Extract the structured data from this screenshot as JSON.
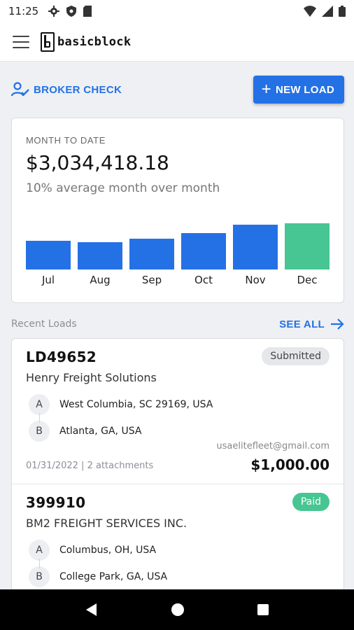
{
  "status_bar": {
    "time": "11:25",
    "left_icons": [
      "settings-icon",
      "shield-icon",
      "sd-card-icon"
    ],
    "right_icons": [
      "wifi-icon",
      "signal-icon",
      "battery-icon"
    ]
  },
  "app_bar": {
    "brand": "basicblock",
    "menu_icon": "hamburger-menu-icon"
  },
  "actions": {
    "broker_check_label": "BROKER CHECK",
    "new_load_label": "NEW LOAD",
    "accent_color": "#2471e6"
  },
  "month_to_date": {
    "label": "MONTH TO DATE",
    "amount": "$3,034,418.18",
    "subtitle": "10% average month over month"
  },
  "chart_data": {
    "type": "bar",
    "categories": [
      "Jul",
      "Aug",
      "Sep",
      "Oct",
      "Nov",
      "Dec"
    ],
    "values": [
      40,
      38,
      43,
      50,
      62,
      64
    ],
    "colors": [
      "#2471e6",
      "#2471e6",
      "#2471e6",
      "#2471e6",
      "#2471e6",
      "#47c593"
    ],
    "ylim": [
      0,
      64
    ],
    "grid": false,
    "title": "",
    "xlabel": "",
    "ylabel": ""
  },
  "recent_loads": {
    "title": "Recent Loads",
    "see_all_label": "SEE ALL",
    "items": [
      {
        "id": "LD49652",
        "broker": "Henry Freight Solutions",
        "status": "Submitted",
        "stop_a_label": "A",
        "stop_a": "West Columbia, SC 29169, USA",
        "stop_b_label": "B",
        "stop_b": "Atlanta, GA, USA",
        "email": "usaelitefleet@gmail.com",
        "meta": "01/31/2022 | 2 attachments",
        "price": "$1,000.00"
      },
      {
        "id": "399910",
        "broker": "BM2 FREIGHT SERVICES INC.",
        "status": "Paid",
        "stop_a_label": "A",
        "stop_a": "Columbus, OH, USA",
        "stop_b_label": "B",
        "stop_b": "College Park, GA, USA"
      }
    ]
  },
  "nav_bar": {
    "icons": [
      "back-icon",
      "home-icon",
      "recents-icon"
    ]
  }
}
